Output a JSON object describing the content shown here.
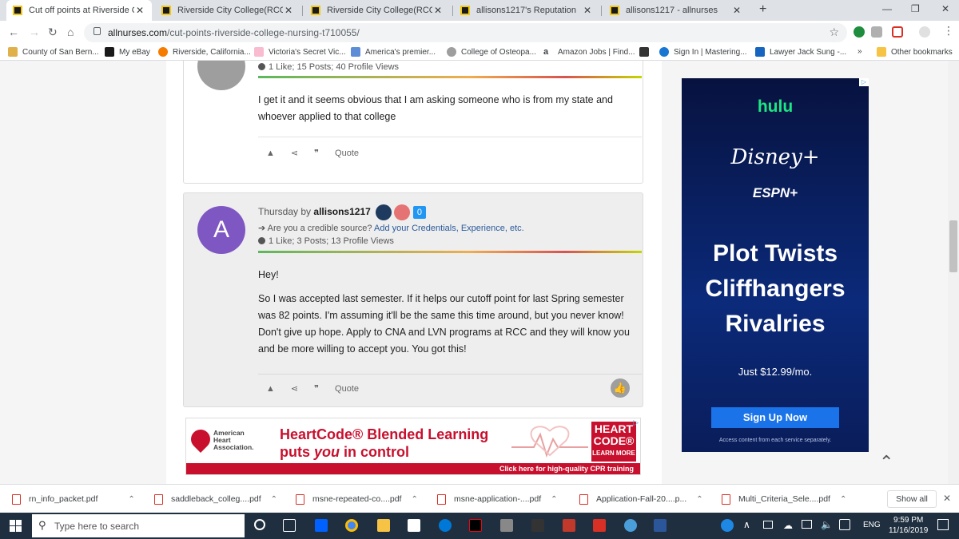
{
  "tabs": [
    {
      "title": "Cut off points at Riverside Colleg",
      "active": true
    },
    {
      "title": "Riverside City College(RCC) Scho",
      "active": false
    },
    {
      "title": "Riverside City College(RCC) Scho",
      "active": false
    },
    {
      "title": "allisons1217's Reputation",
      "active": false
    },
    {
      "title": "allisons1217 - allnurses",
      "active": false
    }
  ],
  "address": {
    "host": "allnurses.com",
    "path": "/cut-points-riverside-college-nursing-t710055/"
  },
  "bookmarks": [
    "County of San Bern...",
    "My eBay",
    "Riverside, California...",
    "Victoria's Secret Vic...",
    "America's premier...",
    "College of Osteopa...",
    "Amazon Jobs | Find...",
    "Sign In | Mastering...",
    "Lawyer Jack Sung -...",
    "»",
    "Other bookmarks"
  ],
  "post1": {
    "stats": "1 Like; 15 Posts; 40 Profile Views",
    "text": "I get it and it seems obvious that I am asking someone who is from my state and whoever applied to that college",
    "quote": "Quote"
  },
  "post2": {
    "avatar_letter": "A",
    "date": "Thursday",
    "by": "by",
    "user": "allisons1217",
    "badge_count": "0",
    "credible_prompt": "Are you a credible source?",
    "credible_link": "Add your Credentials, Experience, etc.",
    "stats": "1 Like; 3 Posts; 13 Profile Views",
    "para1": "Hey!",
    "para2": "So I was accepted last semester. If it helps our cutoff point for last Spring semester was 82 points. I'm assuming it'll be the same this time around, but you never know! Don't give up hope. Apply to CNA and LVN programs at RCC and they will know you and be more willing to accept you. You got this!",
    "quote": "Quote"
  },
  "ad_bottom": {
    "org1": "American",
    "org2": "Heart",
    "org3": "Association.",
    "headline1": "HeartCode® Blended Learning",
    "headline2a": "puts ",
    "headline2b": "you",
    "headline2c": " in control",
    "brand1": "HEART",
    "brand2": "CODE®",
    "learn": "LEARN MORE",
    "cta": "Click here for high-quality CPR training"
  },
  "ad_side": {
    "hulu": "hulu",
    "disney": "Disney+",
    "espn": "ESPN+",
    "line1": "Plot Twists",
    "line2": "Cliffhangers",
    "line3": "Rivalries",
    "price": "Just $12.99/mo.",
    "button": "Sign Up Now",
    "fine": "Access content from each service separately."
  },
  "downloads": {
    "items": [
      "rn_info_packet.pdf",
      "saddleback_colleg....pdf",
      "msne-repeated-co....pdf",
      "msne-application-....pdf",
      "Application-Fall-20....p...",
      "Multi_Criteria_Sele....pdf"
    ],
    "show_all": "Show all"
  },
  "taskbar": {
    "search_placeholder": "Type here to search",
    "lang": "ENG",
    "time": "9:59 PM",
    "date": "11/16/2019"
  },
  "colors": {
    "avatar_purple": "#7e57c2",
    "link_blue": "#2a5a9a",
    "chrome_tab_bg": "#dee1e6",
    "taskbar": "#1f2f3f",
    "ad_red": "#c8102e",
    "ad_blue": "#1a73e8"
  }
}
